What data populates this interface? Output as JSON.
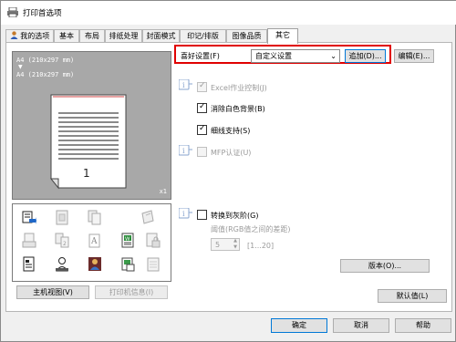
{
  "window": {
    "title": "打印首选项"
  },
  "tabs": [
    {
      "label": "我的选项"
    },
    {
      "label": "基本"
    },
    {
      "label": "布局"
    },
    {
      "label": "排纸处理"
    },
    {
      "label": "封面模式"
    },
    {
      "label": "印记/排版"
    },
    {
      "label": "图像品质"
    },
    {
      "label": "其它"
    }
  ],
  "preview": {
    "paper_line1": "A4 (210x297 mm)",
    "paper_line2": "A4 (210x297 mm)",
    "copies": "x1"
  },
  "left_buttons": {
    "main_view": "主机视图(V)",
    "printer_info": "打印机信息(I)"
  },
  "favorites": {
    "label": "喜好设置(F)",
    "selected": "自定义设置",
    "add": "追加(D)...",
    "edit": "编辑(E)..."
  },
  "options": {
    "excel_control": "Excel作业控制(J)",
    "remove_white_bg": "消除白色背景(B)",
    "thin_line_support": "细线支持(S)",
    "mfp_auth": "MFP认证(U)",
    "convert_gray": "转换到灰阶(G)",
    "threshold_label": "阈值(RGB值之间的差距)",
    "threshold_value": "5",
    "threshold_range": "[1...20]"
  },
  "buttons": {
    "version": "版本(O)...",
    "default": "默认值(L)",
    "ok": "确定",
    "cancel": "取消",
    "help": "帮助"
  },
  "colors": {
    "highlight": "#e00000",
    "accent": "#0078d7"
  }
}
